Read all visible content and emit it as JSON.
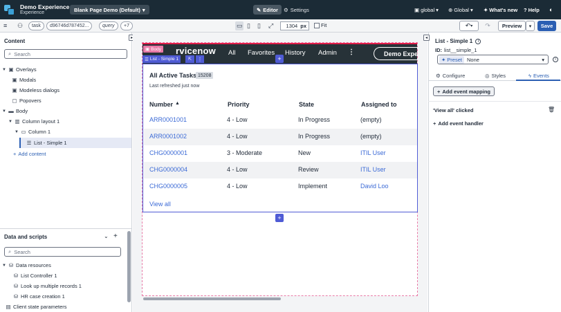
{
  "app": {
    "title": "Demo Experience",
    "subtitle": "Experience",
    "page_selector": "Blank Page Demo (Default)"
  },
  "topnav": {
    "editor": "Editor",
    "settings": "Settings",
    "scope": "global",
    "language": "Global",
    "whats_new": "What's new",
    "help": "Help"
  },
  "toolbar": {
    "pills": [
      "task",
      "d96746d787452...",
      "query",
      "+7"
    ],
    "width_value": "1304",
    "width_unit": "px",
    "fit_label": "Fit",
    "preview_label": "Preview",
    "save_label": "Save"
  },
  "left": {
    "content_title": "Content",
    "search_placeholder": "Search",
    "tree": [
      {
        "label": "Overlays"
      },
      {
        "label": "Modals"
      },
      {
        "label": "Modeless dialogs"
      },
      {
        "label": "Popovers"
      },
      {
        "label": "Body"
      },
      {
        "label": "Column layout 1"
      },
      {
        "label": "Column 1"
      },
      {
        "label": "List - Simple 1"
      }
    ],
    "add_content": "Add content",
    "data_title": "Data and scripts",
    "data_search_placeholder": "Search",
    "data_tree": [
      {
        "label": "Data resources"
      },
      {
        "label": "List Controller 1"
      },
      {
        "label": "Look up multiple records 1"
      },
      {
        "label": "HR case creation 1"
      },
      {
        "label": "Client state parameters"
      }
    ]
  },
  "canvas": {
    "body_tag": "Body",
    "list_tag": "List - Simple 1",
    "brand": "rvicenow",
    "nav": [
      "All",
      "Favorites",
      "History",
      "Admin"
    ],
    "experience_pill": "Demo Experi",
    "list_title": "All Active Tasks",
    "count": "15208",
    "refreshed": "Last refreshed just now",
    "columns": [
      "Number",
      "Priority",
      "State",
      "Assigned to"
    ],
    "rows": [
      [
        "ARR0001001",
        "4 - Low",
        "In Progress",
        "(empty)"
      ],
      [
        "ARR0001002",
        "4 - Low",
        "In Progress",
        "(empty)"
      ],
      [
        "CHG0000001",
        "3 - Moderate",
        "New",
        "ITIL User"
      ],
      [
        "CHG0000004",
        "4 - Low",
        "Review",
        "ITIL User"
      ],
      [
        "CHG0000005",
        "4 - Low",
        "Implement",
        "David Loo"
      ]
    ],
    "view_all": "View all"
  },
  "right": {
    "title": "List - Simple 1",
    "id_label": "ID:",
    "id_value": "list__simple_1",
    "preset_label": "Preset",
    "preset_value": "None",
    "tabs": [
      "Configure",
      "Styles",
      "Events"
    ],
    "active_tab": "Events",
    "add_mapping": "Add event mapping",
    "event_name": "'View all' clicked",
    "add_handler": "Add event handler"
  },
  "colors": {
    "accent": "#2b5fb3",
    "topbar": "#1b2b36",
    "selection": "#4f5bd5",
    "link": "#3b6ad6",
    "page_border": "#e879a6"
  }
}
